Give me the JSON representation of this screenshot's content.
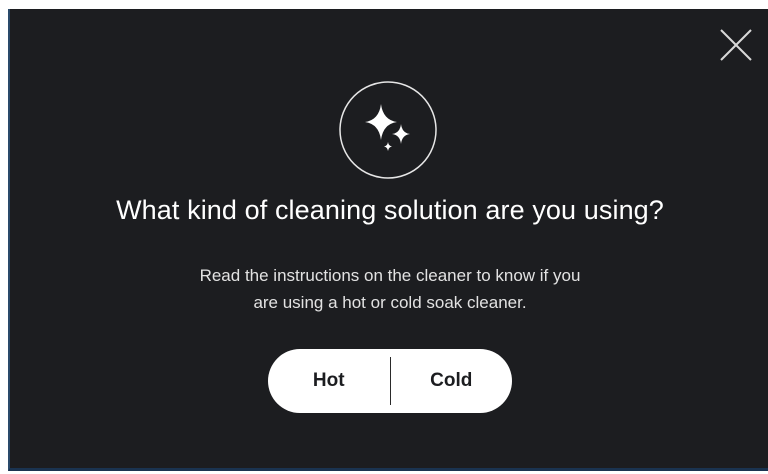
{
  "dialog": {
    "title": "What kind of cleaning solution are you using?",
    "description_line1": "Read the instructions on the cleaner to know if you",
    "description_line2": "are using a hot or cold soak cleaner.",
    "close_icon": "close-icon",
    "badge_icon": "sparkles-icon",
    "options": [
      {
        "label": "Hot"
      },
      {
        "label": "Cold"
      }
    ]
  },
  "colors": {
    "background": "#1c1d20",
    "text": "#ffffff",
    "button_bg": "#ffffff",
    "button_text": "#1c1d20"
  }
}
